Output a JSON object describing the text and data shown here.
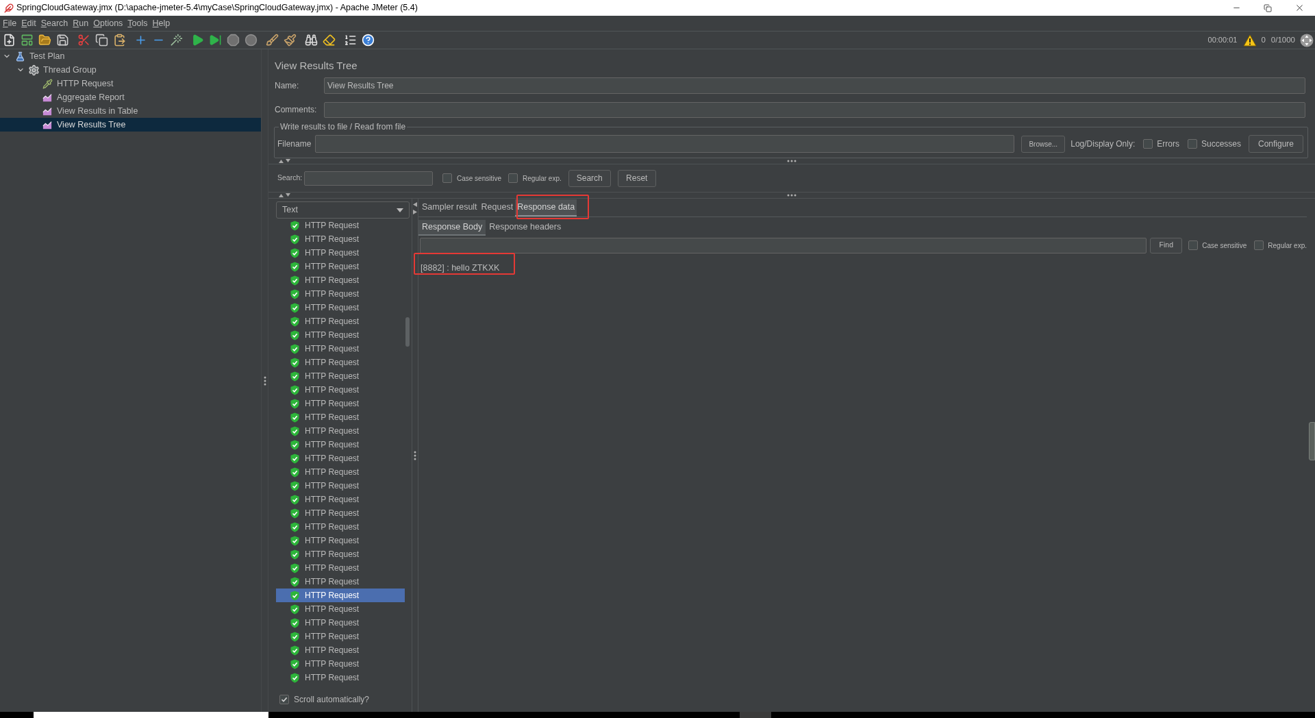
{
  "window": {
    "title": "SpringCloudGateway.jmx (D:\\apache-jmeter-5.4\\myCase\\SpringCloudGateway.jmx) - Apache JMeter (5.4)"
  },
  "menu": [
    "File",
    "Edit",
    "Search",
    "Run",
    "Options",
    "Tools",
    "Help"
  ],
  "toolbar": [
    {
      "kind": "new",
      "disabled": false
    },
    {
      "kind": "templates",
      "disabled": false
    },
    {
      "kind": "open",
      "disabled": false
    },
    {
      "kind": "save",
      "disabled": false
    },
    {
      "kind": "cut",
      "disabled": false
    },
    {
      "kind": "copy",
      "disabled": false
    },
    {
      "kind": "paste",
      "disabled": false
    },
    {
      "kind": "expand",
      "disabled": false
    },
    {
      "kind": "collapse",
      "disabled": false
    },
    {
      "kind": "toggle",
      "disabled": false
    },
    {
      "kind": "start",
      "disabled": false
    },
    {
      "kind": "nopause",
      "disabled": false
    },
    {
      "kind": "stop",
      "disabled": true
    },
    {
      "kind": "shutdown",
      "disabled": true
    },
    {
      "kind": "clear",
      "disabled": false
    },
    {
      "kind": "clearall",
      "disabled": false
    },
    {
      "kind": "search",
      "disabled": false
    },
    {
      "kind": "reset",
      "disabled": false
    },
    {
      "kind": "functions",
      "disabled": false
    },
    {
      "kind": "help",
      "disabled": false
    }
  ],
  "status": {
    "elapsed": "00:00:01",
    "errors": "0",
    "threads": "0/1000"
  },
  "tree": [
    {
      "label": "Test Plan",
      "kind": "plan",
      "expanded": true,
      "selected": false,
      "children": [
        {
          "label": "Thread Group",
          "kind": "group",
          "expanded": true,
          "selected": false,
          "children": [
            {
              "label": "HTTP Request",
              "kind": "sampler",
              "selected": false
            },
            {
              "label": "Aggregate Report",
              "kind": "listener",
              "selected": false
            },
            {
              "label": "View Results in Table",
              "kind": "listener",
              "selected": false
            },
            {
              "label": "View Results Tree",
              "kind": "listener",
              "selected": true
            }
          ]
        }
      ]
    }
  ],
  "panel": {
    "title": "View Results Tree",
    "name": {
      "label": "Name:",
      "value": "View Results Tree"
    },
    "comments": {
      "label": "Comments:"
    },
    "file_group": {
      "title": "Write results to file / Read from file",
      "filename_label": "Filename",
      "browse": "Browse...",
      "log_label": "Log/Display Only:",
      "options": [
        {
          "label": "Errors",
          "checked": false
        },
        {
          "label": "Successes",
          "checked": false
        }
      ],
      "configure": "Configure"
    },
    "search": {
      "label": "Search:",
      "options": [
        {
          "label": "Case sensitive",
          "checked": false
        },
        {
          "label": "Regular exp.",
          "checked": false
        }
      ],
      "buttons": [
        "Search",
        "Reset"
      ]
    }
  },
  "results": {
    "renderer": "Text",
    "items": [
      {
        "label": "HTTP Request",
        "passed": true,
        "selected": false
      },
      {
        "label": "HTTP Request",
        "passed": true,
        "selected": false
      },
      {
        "label": "HTTP Request",
        "passed": true,
        "selected": false
      },
      {
        "label": "HTTP Request",
        "passed": true,
        "selected": false
      },
      {
        "label": "HTTP Request",
        "passed": true,
        "selected": false
      },
      {
        "label": "HTTP Request",
        "passed": true,
        "selected": false
      },
      {
        "label": "HTTP Request",
        "passed": true,
        "selected": false
      },
      {
        "label": "HTTP Request",
        "passed": true,
        "selected": false
      },
      {
        "label": "HTTP Request",
        "passed": true,
        "selected": false
      },
      {
        "label": "HTTP Request",
        "passed": true,
        "selected": false
      },
      {
        "label": "HTTP Request",
        "passed": true,
        "selected": false
      },
      {
        "label": "HTTP Request",
        "passed": true,
        "selected": false
      },
      {
        "label": "HTTP Request",
        "passed": true,
        "selected": false
      },
      {
        "label": "HTTP Request",
        "passed": true,
        "selected": false
      },
      {
        "label": "HTTP Request",
        "passed": true,
        "selected": false
      },
      {
        "label": "HTTP Request",
        "passed": true,
        "selected": false
      },
      {
        "label": "HTTP Request",
        "passed": true,
        "selected": false
      },
      {
        "label": "HTTP Request",
        "passed": true,
        "selected": false
      },
      {
        "label": "HTTP Request",
        "passed": true,
        "selected": false
      },
      {
        "label": "HTTP Request",
        "passed": true,
        "selected": false
      },
      {
        "label": "HTTP Request",
        "passed": true,
        "selected": false
      },
      {
        "label": "HTTP Request",
        "passed": true,
        "selected": false
      },
      {
        "label": "HTTP Request",
        "passed": true,
        "selected": false
      },
      {
        "label": "HTTP Request",
        "passed": true,
        "selected": false
      },
      {
        "label": "HTTP Request",
        "passed": true,
        "selected": false
      },
      {
        "label": "HTTP Request",
        "passed": true,
        "selected": false
      },
      {
        "label": "HTTP Request",
        "passed": true,
        "selected": false
      },
      {
        "label": "HTTP Request",
        "passed": true,
        "selected": true
      },
      {
        "label": "HTTP Request",
        "passed": true,
        "selected": false
      },
      {
        "label": "HTTP Request",
        "passed": true,
        "selected": false
      },
      {
        "label": "HTTP Request",
        "passed": true,
        "selected": false
      },
      {
        "label": "HTTP Request",
        "passed": true,
        "selected": false
      },
      {
        "label": "HTTP Request",
        "passed": true,
        "selected": false
      },
      {
        "label": "HTTP Request",
        "passed": true,
        "selected": false
      }
    ],
    "scroll": {
      "label": "Scroll automatically?",
      "checked": true
    }
  },
  "detail": {
    "tabs": [
      {
        "label": "Sampler result",
        "selected": false,
        "highlighted": false
      },
      {
        "label": "Request",
        "selected": false,
        "highlighted": false
      },
      {
        "label": "Response data",
        "selected": true,
        "highlighted": true
      }
    ],
    "subtabs": [
      {
        "label": "Response Body",
        "selected": true
      },
      {
        "label": "Response headers",
        "selected": false
      }
    ],
    "find": {
      "button": "Find",
      "options": [
        {
          "label": "Case sensitive",
          "checked": false
        },
        {
          "label": "Regular exp.",
          "checked": false
        }
      ]
    },
    "body": {
      "text": "[8882] : hello ZTKXK",
      "highlighted": true
    }
  }
}
